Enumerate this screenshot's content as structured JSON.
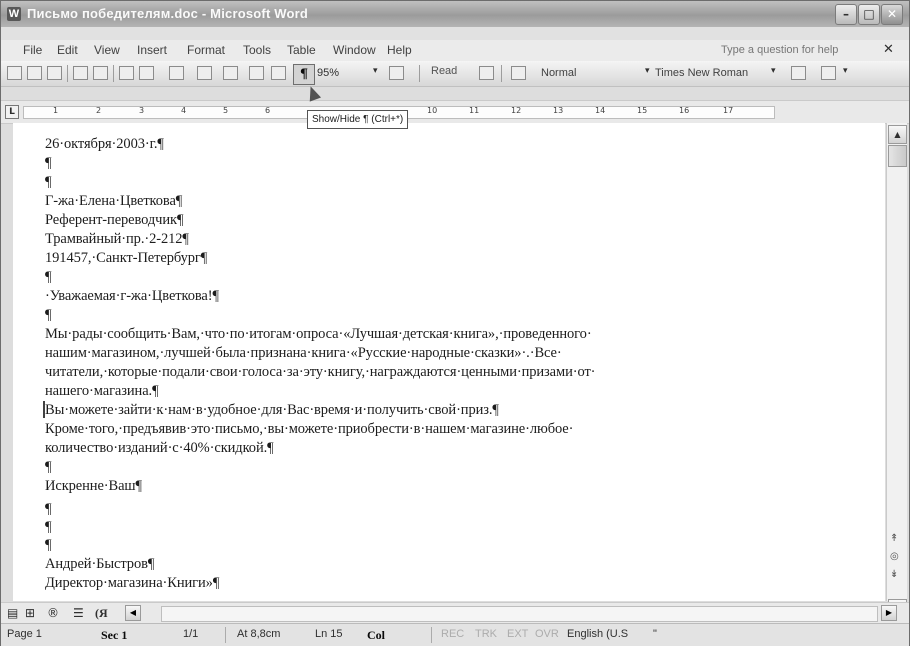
{
  "window": {
    "title": "Письмо победителям.doc - Microsoft Word",
    "app_icon": "W",
    "controls": {
      "minimize": "–",
      "maximize": "□",
      "close": "✕"
    }
  },
  "menu": {
    "items": [
      "File",
      "Edit",
      "View",
      "Insert",
      "Format",
      "Tools",
      "Table",
      "Window",
      "Help"
    ],
    "question_placeholder": "Type a question for help",
    "close_doc": "✕"
  },
  "toolbar": {
    "show_hide": "¶",
    "zoom": "95%",
    "read": "Read",
    "style": "Normal",
    "font": "Times New Roman",
    "icons": [
      "new-icon",
      "open-icon",
      "save-icon",
      "print-icon",
      "print-preview-icon",
      "undo-icon",
      "redo-icon",
      "table-icon",
      "show-hide-icon",
      "help-icon",
      "read-icon",
      "style-icon",
      "font-icon",
      "border-icon",
      "font-color-icon"
    ]
  },
  "tooltip": "Show/Hide ¶ (Ctrl+*)",
  "ruler": {
    "numbers": [
      "1",
      "2",
      "3",
      "4",
      "5",
      "6",
      "10",
      "11",
      "12",
      "13",
      "14",
      "15",
      "16",
      "17"
    ]
  },
  "document": {
    "lines": [
      "26·октября·2003·г.¶",
      "¶",
      "¶",
      "Г-жа·Елена·Цветкова¶",
      "Референт-переводчик¶",
      "Трамвайный·пр.·2-212¶",
      "191457,·Санкт-Петербург¶",
      "¶",
      "·Уважаемая·г-жа·Цветкова!¶",
      "¶",
      "Мы·рады·сообщить·Вам,·что·по·итогам·опроса·«Лучшая·детская·книга»,·проведенного·",
      "нашим·магазином,·лучшей·была·признана·книга·«Русские·народные·сказки»·.·Все·",
      "читатели,·которые·подали·свои·голоса·за·эту·книгу,·награждаются·ценными·призами·от·",
      "нашего·магазина.¶",
      "Вы·можете·зайти·к·нам·в·удобное·для·Вас·время·и·получить·свой·приз.¶",
      "Кроме·того,·предъявив·это·письмо,·вы·можете·приобрести·в·нашем·магазине·любое·",
      "количество·изданий·с·40%·скидкой.¶",
      "¶",
      "Искренне·Ваш¶",
      "¶",
      "¶",
      "¶",
      "Андрей·Быстров¶",
      "Директор·магазина·Книги»¶"
    ]
  },
  "scrollbar": {
    "up": "▲",
    "down": "▼",
    "prev": "↟",
    "select": "◎",
    "next": "↡"
  },
  "view_buttons": [
    "▤",
    "⊞",
    "®",
    "☰",
    "(Я"
  ],
  "status": {
    "page": "Page 1",
    "sec": "Sec 1",
    "pages": "1/1",
    "at": "At 8,8cm",
    "ln": "Ln 15",
    "col": "Col",
    "rec": "REC",
    "trk": "TRK",
    "ext": "EXT",
    "ovr": "OVR",
    "language": "English (U.S",
    "spell": "\""
  }
}
